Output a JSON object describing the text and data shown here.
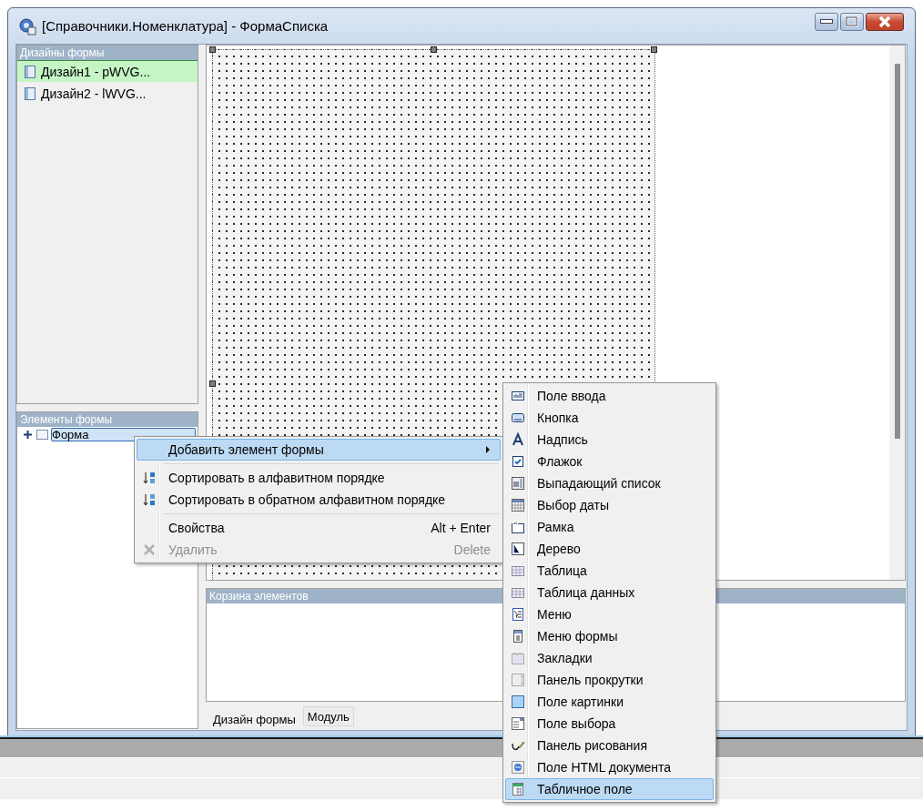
{
  "window": {
    "title": "[Справочники.Номенклатура] - ФормаСписка"
  },
  "designs_panel": {
    "title": "Дизайны формы",
    "items": [
      {
        "label": "Дизайн1 - pWVG...",
        "selected": true
      },
      {
        "label": "Дизайн2 - lWVG...",
        "selected": false
      }
    ]
  },
  "elements_panel": {
    "title": "Элементы формы",
    "tree": [
      {
        "label": "Форма",
        "expanded": false,
        "selected": true
      }
    ]
  },
  "bin_panel": {
    "title": "Корзина элементов"
  },
  "tabs": [
    {
      "label": "Дизайн формы",
      "selected": true
    },
    {
      "label": "Модуль",
      "selected": false
    }
  ],
  "context_menu": {
    "groups": [
      [
        {
          "label": "Добавить элемент формы",
          "has_submenu": true,
          "selected": true,
          "disabled": false
        }
      ],
      [
        {
          "label": "Сортировать в алфавитном порядке",
          "has_submenu": false,
          "selected": false,
          "disabled": false
        },
        {
          "label": "Сортировать в обратном алфавитном порядке",
          "has_submenu": false,
          "selected": false,
          "disabled": false
        }
      ],
      [
        {
          "label": "Свойства",
          "shortcut": "Alt + Enter",
          "has_submenu": false,
          "selected": false,
          "disabled": false
        },
        {
          "label": "Удалить",
          "shortcut": "Delete",
          "has_submenu": false,
          "selected": false,
          "disabled": true
        }
      ]
    ]
  },
  "submenu": {
    "items": [
      {
        "label": "Поле ввода",
        "selected": false
      },
      {
        "label": "Кнопка",
        "selected": false
      },
      {
        "label": "Надпись",
        "selected": false
      },
      {
        "label": "Флажок",
        "selected": false
      },
      {
        "label": "Выпадающий список",
        "selected": false
      },
      {
        "label": "Выбор даты",
        "selected": false
      },
      {
        "label": "Рамка",
        "selected": false
      },
      {
        "label": "Дерево",
        "selected": false
      },
      {
        "label": "Таблица",
        "selected": false
      },
      {
        "label": "Таблица данных",
        "selected": false
      },
      {
        "label": "Меню",
        "selected": false
      },
      {
        "label": "Меню формы",
        "selected": false
      },
      {
        "label": "Закладки",
        "selected": false
      },
      {
        "label": "Панель прокрутки",
        "selected": false
      },
      {
        "label": "Поле картинки",
        "selected": false
      },
      {
        "label": "Поле выбора",
        "selected": false
      },
      {
        "label": "Панель рисования",
        "selected": false
      },
      {
        "label": "Поле HTML документа",
        "selected": false
      },
      {
        "label": "Табличное поле",
        "selected": true
      }
    ]
  }
}
